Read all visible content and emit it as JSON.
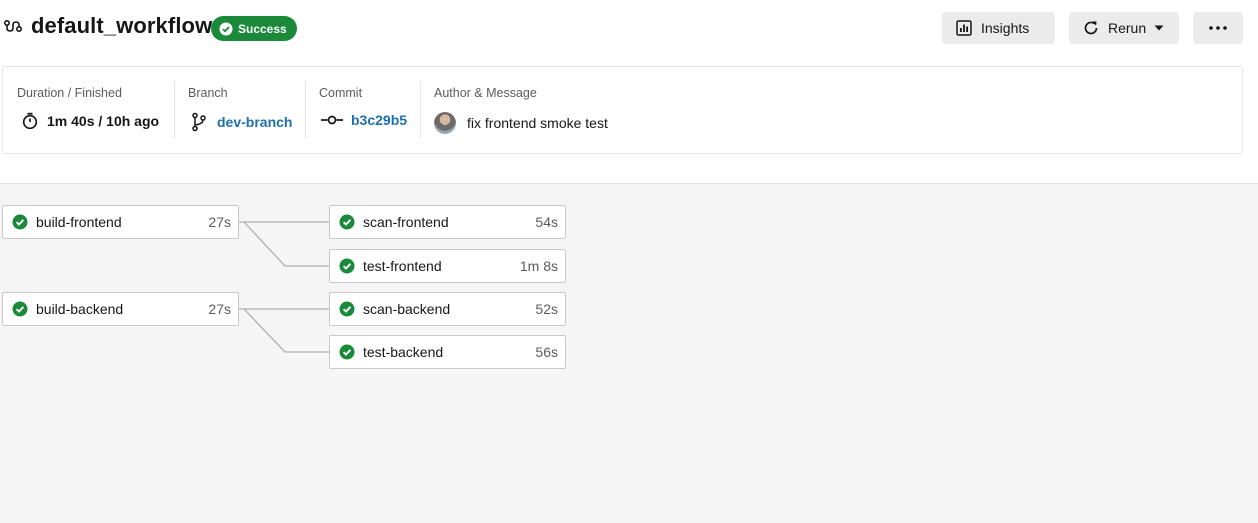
{
  "header": {
    "title": "default_workflow",
    "status": "Success",
    "insights_label": "Insights",
    "rerun_label": "Rerun",
    "more_label": "•••"
  },
  "info": {
    "duration": {
      "label": "Duration / Finished",
      "value": "1m 40s / 10h ago"
    },
    "branch": {
      "label": "Branch",
      "value": "dev-branch"
    },
    "commit": {
      "label": "Commit",
      "value": "b3c29b5"
    },
    "author": {
      "label": "Author & Message",
      "message": "fix frontend smoke test"
    }
  },
  "jobs": {
    "build_frontend": {
      "name": "build-frontend",
      "duration": "27s"
    },
    "scan_frontend": {
      "name": "scan-frontend",
      "duration": "54s"
    },
    "test_frontend": {
      "name": "test-frontend",
      "duration": "1m 8s"
    },
    "build_backend": {
      "name": "build-backend",
      "duration": "27s"
    },
    "scan_backend": {
      "name": "scan-backend",
      "duration": "52s"
    },
    "test_backend": {
      "name": "test-backend",
      "duration": "56s"
    }
  },
  "colors": {
    "success": "#1a8a3a",
    "link": "#1f6fae",
    "canvas": "#f5f5f5"
  }
}
